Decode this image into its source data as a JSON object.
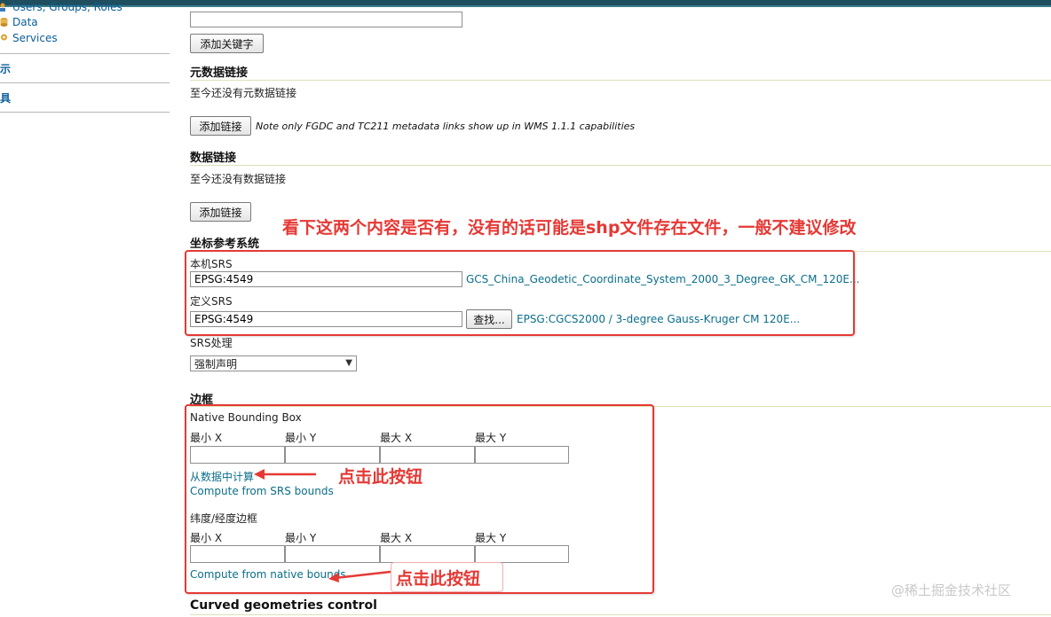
{
  "sidebar": {
    "item_users": "Users, Groups, Roles",
    "item_data": "Data",
    "item_services": "Services",
    "head_demo": "演示",
    "head_tools": "工具"
  },
  "keywords": {
    "add_button": "添加关键字"
  },
  "metadata_links": {
    "title": "元数据链接",
    "empty": "至今还没有元数据链接",
    "add_button": "添加链接",
    "note": "Note only FGDC and TC211 metadata links show up in WMS 1.1.1 capabilities"
  },
  "data_links": {
    "title": "数据链接",
    "empty": "至今还没有数据链接",
    "add_button": "添加链接"
  },
  "crs": {
    "title": "坐标参考系统",
    "native_label": "本机SRS",
    "native_value": "EPSG:4549",
    "native_desc": "GCS_China_Geodetic_Coordinate_System_2000_3_Degree_GK_CM_120E...",
    "declared_label": "定义SRS",
    "declared_value": "EPSG:4549",
    "find_button": "查找...",
    "declared_desc": "EPSG:CGCS2000 / 3-degree Gauss-Kruger CM 120E...",
    "handling_label": "SRS处理",
    "handling_value": "强制声明"
  },
  "bbox": {
    "title": "边框",
    "native_label": "Native Bounding Box",
    "latlon_label": "纬度/经度边框",
    "min_x": "最小 X",
    "min_y": "最小 Y",
    "max_x": "最大 X",
    "max_y": "最大 Y",
    "compute_from_data": "从数据中计算",
    "compute_from_srs": "Compute from SRS bounds",
    "compute_from_native": "Compute from native bounds"
  },
  "curved": {
    "title": "Curved geometries control"
  },
  "annotations": {
    "top_note": "看下这两个内容是否有，没有的话可能是shp文件存在文件，一般不建议修改",
    "click_1": "点击此按钮",
    "click_2": "点击此按钮",
    "watermark": "@稀土掘金技术社区"
  },
  "colors": {
    "accent_red": "#e53935",
    "link_blue": "#0b6e8a",
    "topbar": "#1f4f5e"
  }
}
